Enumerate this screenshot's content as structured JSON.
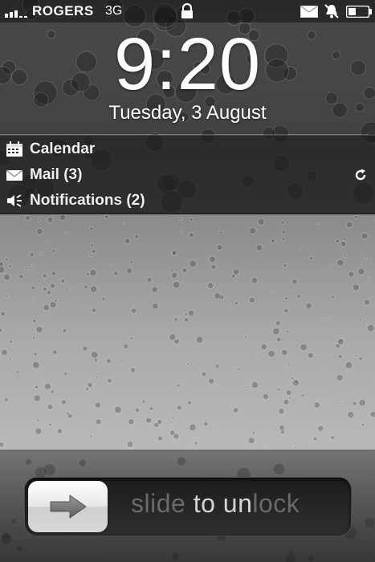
{
  "status_bar": {
    "carrier": "ROGERS",
    "network": "3G",
    "icons": [
      "signal-bars-icon",
      "lock-icon",
      "mail-icon",
      "mute-icon",
      "battery-icon"
    ]
  },
  "lock_screen": {
    "time": "9:20",
    "date": "Tuesday, 3 August"
  },
  "notifications": [
    {
      "icon": "calendar-icon",
      "label": "Calendar"
    },
    {
      "icon": "envelope-icon",
      "label": "Mail (3)",
      "action_icon": "refresh-icon"
    },
    {
      "icon": "speaker-icon",
      "label": "Notifications (2)"
    }
  ],
  "unlock": {
    "slide_text_1": "slide ",
    "slide_text_2": "to un",
    "slide_text_3": "lock",
    "knob_icon": "arrow-right-icon"
  },
  "colors": {
    "panel_bg": "#161616",
    "text": "#ffffff",
    "slide_text_dim": "#6a6a6a",
    "slide_text_bright": "#d4d4d4"
  }
}
